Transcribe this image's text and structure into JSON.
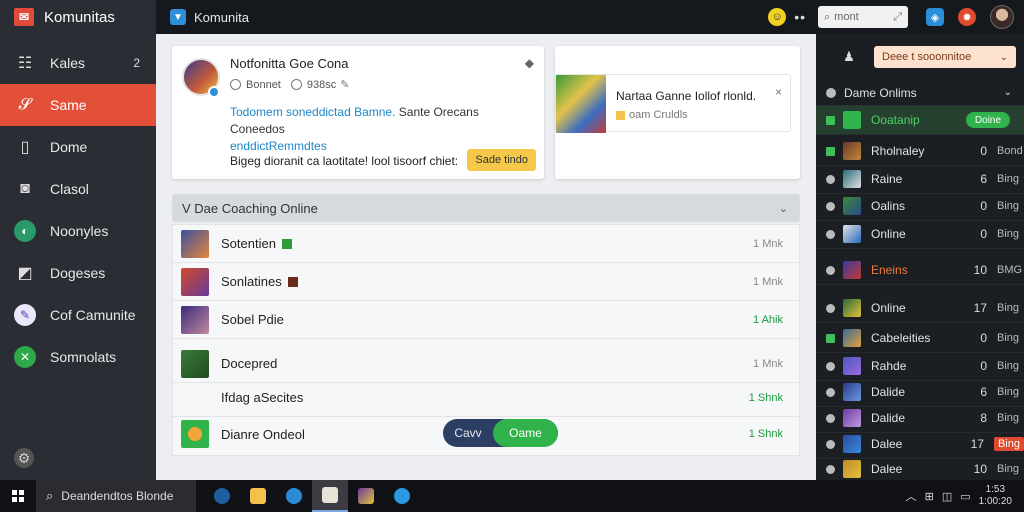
{
  "app": {
    "title": "Komunitas"
  },
  "document": {
    "title": "Komunita"
  },
  "topbar": {
    "search_placeholder": "mont"
  },
  "sidebar": {
    "items": [
      {
        "label": "Kales",
        "count": "2",
        "icon": "grid-icon"
      },
      {
        "label": "Same",
        "count": "",
        "icon": "games-icon",
        "active": true
      },
      {
        "label": "Dome",
        "count": "",
        "icon": "document-icon"
      },
      {
        "label": "Clasol",
        "count": "",
        "icon": "camera-icon"
      },
      {
        "label": "Noonyles",
        "count": "",
        "icon": "globe-icon"
      },
      {
        "label": "Dogeses",
        "count": "",
        "icon": "shop-icon"
      },
      {
        "label": "Cof Camunite",
        "count": "",
        "icon": "feather-icon"
      },
      {
        "label": "Somnolats",
        "count": "",
        "icon": "xbox-icon"
      }
    ]
  },
  "notification": {
    "title": "Notfonitta Goe Cona",
    "meta_a": "Bonnet",
    "meta_b": "938sc",
    "body_link": "Todomem soneddictad Bamne.",
    "body_text": "Sante Orecans Coneedos",
    "body_link2": "enddictRemmdtes",
    "footer": "Bigeg dioranit ca laotitate! lool tisoorf chiet:",
    "action_label": "Sade tindo",
    "close": "◆"
  },
  "promo": {
    "title": "Nartaa Ganne Iollof rlonld.",
    "subtitle": "oam Cruldls",
    "close": "×"
  },
  "list": {
    "header": "V Dae Coaching Online",
    "rows": [
      {
        "name": "Sotentien",
        "flag": "#2f9a3a",
        "status": "1 Mnk",
        "green": false,
        "thumb": "linear-gradient(135deg,#3b4fa0,#e2873a)"
      },
      {
        "name": "Sonlatines",
        "flag": "#6a2a1a",
        "status": "1 Mnk",
        "green": false,
        "thumb": "linear-gradient(135deg,#d04a2a,#6a3a9a)"
      },
      {
        "name": "Sobel Pdie",
        "flag": "",
        "status": "1 Ahik",
        "green": true,
        "thumb": "linear-gradient(135deg,#3a2a7a,#c28aa0)"
      },
      {
        "name": "Docepred",
        "flag": "",
        "status": "1 Mnk",
        "green": false,
        "thumb": "linear-gradient(135deg,#3a7a3a,#1f4a1f)"
      },
      {
        "name": "Ifdag aSecites",
        "flag": "",
        "status": "1 Shnk",
        "green": true,
        "thumb": ""
      },
      {
        "name": "Dianre Ondeol",
        "flag": "",
        "status": "1 Shnk",
        "green": true,
        "thumb": "radial-gradient(circle,#f2a43a 0 35%,#2fb34a 36%)"
      }
    ]
  },
  "toggle": {
    "option_a": "Cavv",
    "option_b": "Oame"
  },
  "right_panel": {
    "dropdown": "Deee t sooonnitoe",
    "section_title": "Dame Onlims",
    "rows": [
      {
        "name": "Ooatanip",
        "num": "",
        "val": "",
        "style": "green",
        "highlight": true,
        "button": "Doine",
        "dot": "green",
        "avatar": "#2fb34a"
      },
      {
        "name": "Rholnaley",
        "num": "0",
        "val": "Bond",
        "style": "",
        "highlight": false,
        "button": "",
        "dot": "sq",
        "avatar": "linear-gradient(135deg,#6a3a2a,#c2873a)"
      },
      {
        "name": "Raine",
        "num": "6",
        "val": "Bing",
        "style": "",
        "highlight": false,
        "button": "",
        "dot": "",
        "avatar": "linear-gradient(135deg,#2a6a7a,#e2e2e2)"
      },
      {
        "name": "Oalins",
        "num": "0",
        "val": "Bing",
        "style": "",
        "highlight": false,
        "button": "",
        "dot": "",
        "avatar": "linear-gradient(135deg,#3a8a3a,#2a4a8a)"
      },
      {
        "name": "Online",
        "num": "0",
        "val": "Bing",
        "style": "",
        "highlight": false,
        "button": "",
        "dot": "",
        "avatar": "linear-gradient(135deg,#e2e2e2,#2a6ac0)"
      },
      {
        "name": "Eneins",
        "num": "10",
        "val": "BMG",
        "style": "orange",
        "highlight": false,
        "button": "",
        "dot": "",
        "avatar": "linear-gradient(135deg,#3a3a9a,#c23a3a)"
      },
      {
        "name": "Online",
        "num": "17",
        "val": "Bing",
        "style": "",
        "highlight": false,
        "button": "",
        "dot": "",
        "avatar": "linear-gradient(135deg,#2a6a3a,#e2c23a)"
      },
      {
        "name": "Cabeleities",
        "num": "0",
        "val": "Bing",
        "style": "",
        "highlight": false,
        "button": "",
        "dot": "sq",
        "avatar": "linear-gradient(135deg,#3a6a9a,#e2a23a)"
      },
      {
        "name": "Rahde",
        "num": "0",
        "val": "Bing",
        "style": "",
        "highlight": false,
        "button": "",
        "dot": "",
        "avatar": "linear-gradient(135deg,#4a5ac0,#9a6ae0)"
      },
      {
        "name": "Dalide",
        "num": "6",
        "val": "Bing",
        "style": "",
        "highlight": false,
        "button": "",
        "dot": "",
        "avatar": "linear-gradient(135deg,#2a3a8a,#6a9ae0)"
      },
      {
        "name": "Dalide",
        "num": "8",
        "val": "Bing",
        "style": "",
        "highlight": false,
        "button": "",
        "dot": "",
        "avatar": "linear-gradient(135deg,#6a3aa0,#c29ae0)"
      },
      {
        "name": "Dalee",
        "num": "17",
        "val": "Bing",
        "style": "",
        "highlight": false,
        "button": "",
        "dot": "",
        "red": true,
        "avatar": "linear-gradient(135deg,#2a4a9a,#3a8ae0)"
      },
      {
        "name": "Dalee",
        "num": "10",
        "val": "Bing",
        "style": "",
        "highlight": false,
        "button": "",
        "dot": "",
        "avatar": "linear-gradient(135deg,#c28a2a,#e2c23a)"
      }
    ]
  },
  "taskbar": {
    "search_text": "Deandendtos Blonde",
    "clock_time": "1:53",
    "clock_date": "1:00:20"
  }
}
